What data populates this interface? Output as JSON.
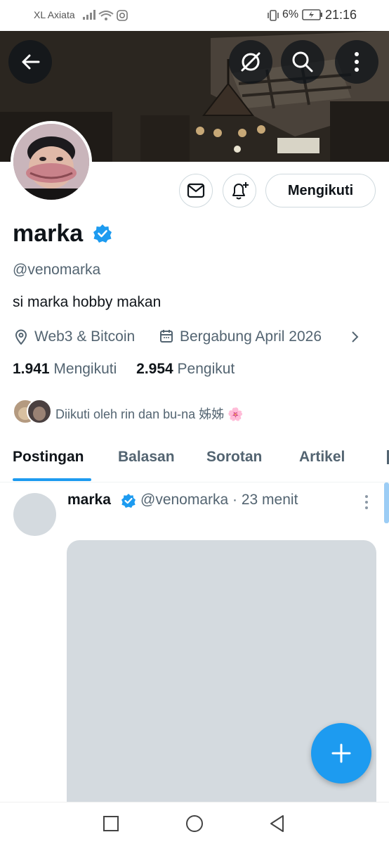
{
  "status_bar": {
    "carrier": "XL Axiata",
    "battery_percent": "6%",
    "time": "21:16"
  },
  "header": {
    "back_icon": "arrow-left-icon",
    "grok_icon": "slash-circle-icon",
    "search_icon": "search-icon",
    "more_icon": "more-vertical-icon"
  },
  "profile": {
    "name": "marka",
    "handle": "@venomarka",
    "bio": "si marka hobby makan",
    "location": "Web3 & Bitcoin",
    "joined": "Bergabung April 2026",
    "following_count": "1.941",
    "following_label": "Mengikuti",
    "followers_count": "2.954",
    "followers_label": "Pengikut",
    "followed_by": "Diikuti oleh rin dan bu-na 姊姊 🌸",
    "follow_button": "Mengikuti"
  },
  "tabs": [
    "Postingan",
    "Balasan",
    "Sorotan",
    "Artikel"
  ],
  "post": {
    "name": "marka",
    "meta": "@venomarka · 23 menit"
  },
  "colors": {
    "accent": "#1d9bf0",
    "text_primary": "#0f1419",
    "text_secondary": "#536471"
  }
}
